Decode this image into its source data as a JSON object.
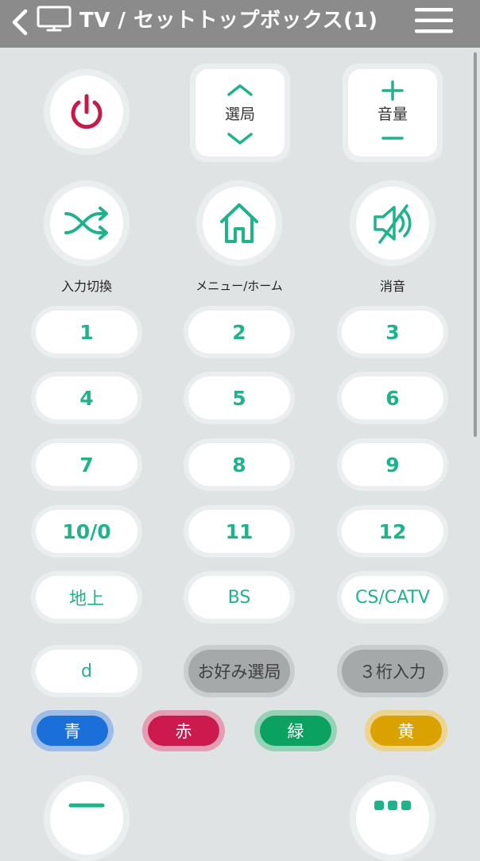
{
  "header": {
    "title": "TV / セットトップボックス(1)"
  },
  "controls": {
    "channel_label": "選局",
    "volume_label": "音量",
    "input_label": "入力切換",
    "home_label": "メニュー/ホーム",
    "mute_label": "消音"
  },
  "keypad": [
    "1",
    "2",
    "3",
    "4",
    "5",
    "6",
    "7",
    "8",
    "9",
    "10/0",
    "11",
    "12"
  ],
  "broadcast": {
    "terrestrial": "地上",
    "bs": "BS",
    "cs": "CS/CATV"
  },
  "extra": {
    "d": "d",
    "favorite": "お好み選局",
    "three_digit": "３桁入力"
  },
  "color_buttons": [
    {
      "label": "青",
      "color": "#1a6fd8",
      "ring": "#9dbce6"
    },
    {
      "label": "赤",
      "color": "#cc1a4f",
      "ring": "#e59db3"
    },
    {
      "label": "緑",
      "color": "#0aa161",
      "ring": "#96d3b6"
    },
    {
      "label": "黄",
      "color": "#d9a200",
      "ring": "#ecd48e"
    }
  ],
  "colors": {
    "accent": "#1fb38b",
    "power": "#c8194b",
    "header": "#8b8b8b"
  }
}
